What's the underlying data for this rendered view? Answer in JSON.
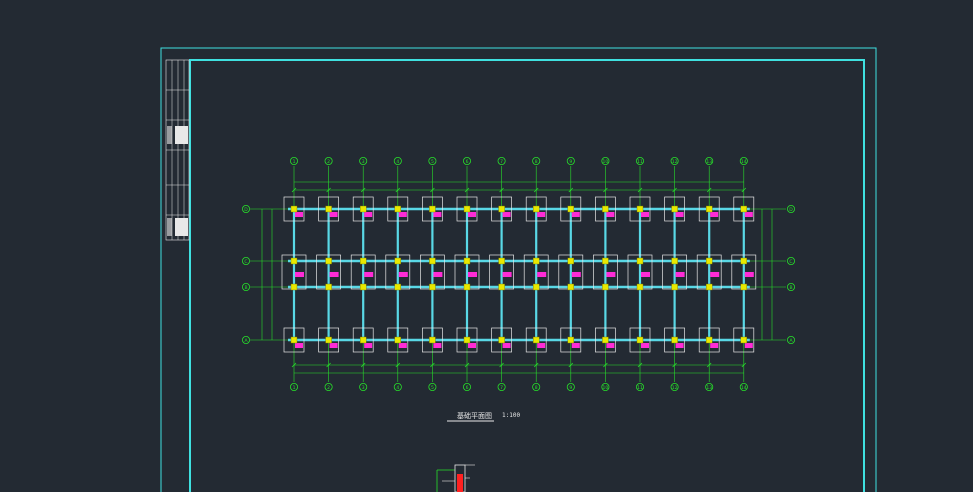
{
  "drawing": {
    "title": "基础平面图",
    "scale": "1:100",
    "colors": {
      "background": "#232a33",
      "frame": "#3fe0e0",
      "axis": "#27e02a",
      "beam": "#59d8e6",
      "footing": "#e8e8e8",
      "column": "#e8e800",
      "tag": "#ff2bd6",
      "red": "#ff2020"
    },
    "column_axes": [
      "1",
      "2",
      "3",
      "4",
      "5",
      "6",
      "7",
      "8",
      "9",
      "10",
      "11",
      "12",
      "13",
      "14"
    ],
    "row_axes": [
      "D",
      "C",
      "B",
      "A"
    ],
    "footing_tag": "JC-1"
  }
}
